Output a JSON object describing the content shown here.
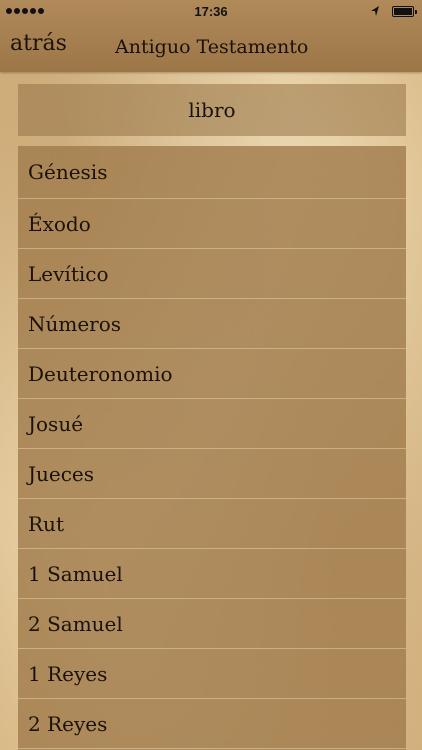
{
  "status_bar": {
    "time": "17:36"
  },
  "nav": {
    "back_label": "atrás",
    "title": "Antiguo Testamento"
  },
  "section": {
    "header": "libro"
  },
  "books": [
    {
      "label": "Génesis"
    },
    {
      "label": "Éxodo"
    },
    {
      "label": "Levítico"
    },
    {
      "label": "Números"
    },
    {
      "label": "Deuteronomio"
    },
    {
      "label": "Josué"
    },
    {
      "label": "Jueces"
    },
    {
      "label": "Rut"
    },
    {
      "label": "1 Samuel"
    },
    {
      "label": "2 Samuel"
    },
    {
      "label": "1 Reyes"
    },
    {
      "label": "2 Reyes"
    }
  ]
}
